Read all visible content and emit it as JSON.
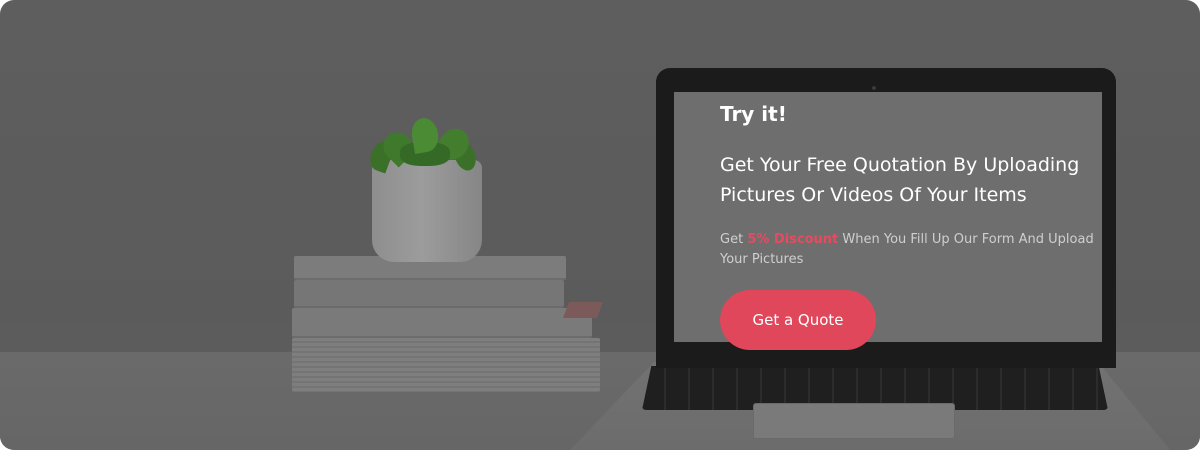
{
  "hero": {
    "eyebrow": "Try it!",
    "headline": "Get Your Free Quotation By Uploading Pictures Or Videos Of Your Items",
    "subtext": {
      "before": "Get ",
      "highlight": "5% Discount",
      "after": " When You Fill Up Our Form And Upload Your Pictures"
    },
    "cta_label": "Get a Quote"
  },
  "colors": {
    "accent": "#e0475a",
    "highlight_text": "#e84a5f",
    "overlay": "#5e5e5e"
  },
  "background_image": {
    "depicts": [
      "laptop-icon",
      "potted-succulent-icon",
      "book-stack-icon"
    ]
  }
}
